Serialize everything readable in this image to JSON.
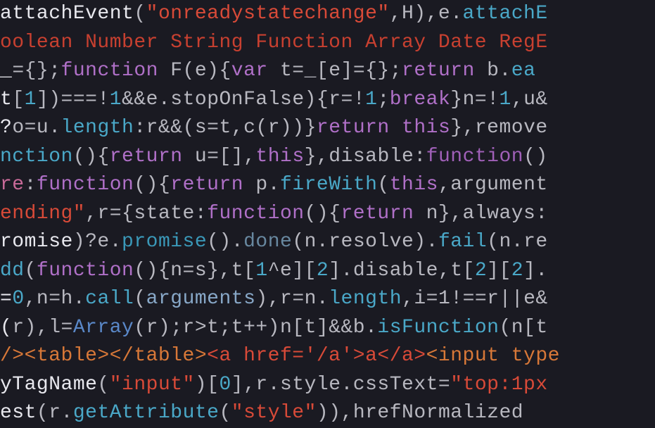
{
  "code": {
    "lines": [
      [
        {
          "c": "white",
          "t": "attachEvent"
        },
        {
          "c": "grey",
          "t": "("
        },
        {
          "c": "red",
          "t": "\"onreadystatechange\""
        },
        {
          "c": "grey",
          "t": ",H),e."
        },
        {
          "c": "teal",
          "t": "attachE"
        }
      ],
      [
        {
          "c": "red2",
          "t": "oolean Number String Function Array Date RegE"
        }
      ],
      [
        {
          "c": "white",
          "t": "_"
        },
        {
          "c": "grey",
          "t": "={};"
        },
        {
          "c": "purple",
          "t": "function"
        },
        {
          "c": "grey",
          "t": " F(e){"
        },
        {
          "c": "purple",
          "t": "var"
        },
        {
          "c": "grey",
          "t": " t=_[e]={};"
        },
        {
          "c": "purple",
          "t": "return"
        },
        {
          "c": "grey",
          "t": " b."
        },
        {
          "c": "teal",
          "t": "ea"
        }
      ],
      [
        {
          "c": "white",
          "t": "t"
        },
        {
          "c": "grey",
          "t": "["
        },
        {
          "c": "teal",
          "t": "1"
        },
        {
          "c": "grey",
          "t": "])===!"
        },
        {
          "c": "teal",
          "t": "1"
        },
        {
          "c": "grey",
          "t": "&&e.stopOnFalse){r=!"
        },
        {
          "c": "teal",
          "t": "1"
        },
        {
          "c": "grey",
          "t": ";"
        },
        {
          "c": "purple",
          "t": "break"
        },
        {
          "c": "grey",
          "t": "}n=!"
        },
        {
          "c": "teal",
          "t": "1"
        },
        {
          "c": "grey",
          "t": ",u&"
        }
      ],
      [
        {
          "c": "white",
          "t": "?"
        },
        {
          "c": "grey",
          "t": "o=u."
        },
        {
          "c": "teal",
          "t": "length"
        },
        {
          "c": "grey",
          "t": ":r&&(s=t,c(r))}"
        },
        {
          "c": "purple",
          "t": "return"
        },
        {
          "c": "grey",
          "t": " "
        },
        {
          "c": "purple",
          "t": "this"
        },
        {
          "c": "grey",
          "t": "},remove"
        }
      ],
      [
        {
          "c": "teal",
          "t": "nction"
        },
        {
          "c": "grey",
          "t": "(){"
        },
        {
          "c": "purple",
          "t": "return"
        },
        {
          "c": "grey",
          "t": " u=[],"
        },
        {
          "c": "purple",
          "t": "this"
        },
        {
          "c": "grey",
          "t": "},disable:"
        },
        {
          "c": "purple2",
          "t": "function"
        },
        {
          "c": "grey",
          "t": "()"
        }
      ],
      [
        {
          "c": "pink",
          "t": "re"
        },
        {
          "c": "grey",
          "t": ":"
        },
        {
          "c": "purple",
          "t": "function"
        },
        {
          "c": "grey",
          "t": "(){"
        },
        {
          "c": "purple",
          "t": "return"
        },
        {
          "c": "grey",
          "t": " p."
        },
        {
          "c": "teal",
          "t": "fireWith"
        },
        {
          "c": "grey",
          "t": "("
        },
        {
          "c": "purple",
          "t": "this"
        },
        {
          "c": "grey",
          "t": ",argument"
        }
      ],
      [
        {
          "c": "red",
          "t": "ending\""
        },
        {
          "c": "grey",
          "t": ",r={state:"
        },
        {
          "c": "purple",
          "t": "function"
        },
        {
          "c": "grey",
          "t": "(){"
        },
        {
          "c": "purple",
          "t": "return"
        },
        {
          "c": "grey",
          "t": " n},always:"
        }
      ],
      [
        {
          "c": "white",
          "t": "romise"
        },
        {
          "c": "grey",
          "t": ")?e."
        },
        {
          "c": "teal2",
          "t": "promise"
        },
        {
          "c": "grey",
          "t": "()."
        },
        {
          "c": "slate",
          "t": "done"
        },
        {
          "c": "grey",
          "t": "(n.resolve)."
        },
        {
          "c": "teal",
          "t": "fail"
        },
        {
          "c": "grey",
          "t": "(n.re"
        }
      ],
      [
        {
          "c": "teal",
          "t": "dd"
        },
        {
          "c": "grey",
          "t": "("
        },
        {
          "c": "purple",
          "t": "function"
        },
        {
          "c": "grey",
          "t": "(){n=s},t["
        },
        {
          "c": "teal",
          "t": "1"
        },
        {
          "c": "grey",
          "t": "^e]["
        },
        {
          "c": "teal",
          "t": "2"
        },
        {
          "c": "grey",
          "t": "].disable,t["
        },
        {
          "c": "teal",
          "t": "2"
        },
        {
          "c": "grey",
          "t": "]["
        },
        {
          "c": "teal",
          "t": "2"
        },
        {
          "c": "grey",
          "t": "]."
        }
      ],
      [
        {
          "c": "white",
          "t": "="
        },
        {
          "c": "teal",
          "t": "0"
        },
        {
          "c": "grey",
          "t": ",n=h."
        },
        {
          "c": "teal",
          "t": "call"
        },
        {
          "c": "grey",
          "t": "("
        },
        {
          "c": "ltblue",
          "t": "arguments"
        },
        {
          "c": "grey",
          "t": "),r=n."
        },
        {
          "c": "teal",
          "t": "length"
        },
        {
          "c": "grey",
          "t": ",i=1!==r||e&"
        }
      ],
      [
        {
          "c": "white",
          "t": "("
        },
        {
          "c": "grey",
          "t": "r),l="
        },
        {
          "c": "blue",
          "t": "Array"
        },
        {
          "c": "grey",
          "t": "(r);r>t;t++)n[t]&&b."
        },
        {
          "c": "teal",
          "t": "isFunction"
        },
        {
          "c": "grey",
          "t": "(n[t"
        }
      ],
      [
        {
          "c": "orange",
          "t": "/><table></table>"
        },
        {
          "c": "red",
          "t": "<a href='/a'>a</a>"
        },
        {
          "c": "orange",
          "t": "<input type"
        }
      ],
      [
        {
          "c": "white",
          "t": "yTagName"
        },
        {
          "c": "grey",
          "t": "("
        },
        {
          "c": "red",
          "t": "\"input\""
        },
        {
          "c": "grey",
          "t": ")["
        },
        {
          "c": "teal",
          "t": "0"
        },
        {
          "c": "grey",
          "t": "],r.style.cssText="
        },
        {
          "c": "red",
          "t": "\"top:1px"
        }
      ],
      [
        {
          "c": "white",
          "t": "est"
        },
        {
          "c": "grey",
          "t": "(r."
        },
        {
          "c": "teal",
          "t": "getAttribute"
        },
        {
          "c": "grey",
          "t": "("
        },
        {
          "c": "red",
          "t": "\"style\""
        },
        {
          "c": "grey",
          "t": ")),hrefNormalized"
        }
      ]
    ]
  }
}
